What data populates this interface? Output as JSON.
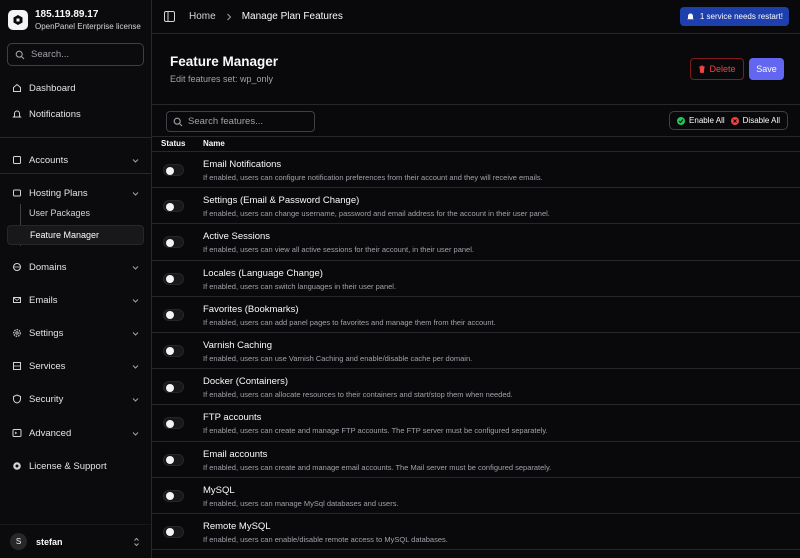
{
  "brand": {
    "ip": "185.119.89.17",
    "license": "OpenPanel Enterprise license"
  },
  "sidebar": {
    "search_placeholder": "Search...",
    "dashboard": "Dashboard",
    "notifications": "Notifications",
    "accounts": "Accounts",
    "hosting_plans": "Hosting Plans",
    "user_packages": "User Packages",
    "feature_manager": "Feature Manager",
    "domains": "Domains",
    "emails": "Emails",
    "settings": "Settings",
    "services": "Services",
    "security": "Security",
    "advanced": "Advanced",
    "license_support": "License & Support"
  },
  "user": {
    "initial": "S",
    "name": "stefan"
  },
  "topbar": {
    "breadcrumb_home": "Home",
    "breadcrumb_current": "Manage Plan Features",
    "restart_notice": "1 service needs restart!"
  },
  "header": {
    "title": "Feature Manager",
    "subtitle": "Edit features set: wp_only",
    "delete_label": "Delete",
    "save_label": "Save"
  },
  "toolbar": {
    "search_placeholder": "Search features...",
    "enable_all": "Enable All",
    "disable_all": "Disable All"
  },
  "table": {
    "col_status": "Status",
    "col_name": "Name",
    "rows": [
      {
        "name": "Email Notifications",
        "desc": "If enabled, users can configure notification preferences from their account and they will receive emails.",
        "enabled": false
      },
      {
        "name": "Settings (Email & Password Change)",
        "desc": "If enabled, users can change username, password and email address for the account in their user panel.",
        "enabled": false
      },
      {
        "name": "Active Sessions",
        "desc": "If enabled, users can view all active sessions for their account, in their user panel.",
        "enabled": false
      },
      {
        "name": "Locales (Language Change)",
        "desc": "If enabled, users can switch languages in their user panel.",
        "enabled": false
      },
      {
        "name": "Favorites (Bookmarks)",
        "desc": "If enabled, users can add panel pages to favorites and manage them from their account.",
        "enabled": false
      },
      {
        "name": "Varnish Caching",
        "desc": "If enabled, users can use Varnish Caching and enable/disable cache per domain.",
        "enabled": false
      },
      {
        "name": "Docker (Containers)",
        "desc": "If enabled, users can allocate resources to their containers and start/stop them when needed.",
        "enabled": false
      },
      {
        "name": "FTP accounts",
        "desc": "If enabled, users can create and manage FTP accounts. The FTP server must be configured separately.",
        "enabled": false
      },
      {
        "name": "Email accounts",
        "desc": "If enabled, users can create and manage email accounts. The Mail server must be configured separately.",
        "enabled": false
      },
      {
        "name": "MySQL",
        "desc": "If enabled, users can manage MySql databases and users.",
        "enabled": false
      },
      {
        "name": "Remote MySQL",
        "desc": "If enabled, users can enable/disable remote access to MySQL databases.",
        "enabled": false
      }
    ]
  }
}
